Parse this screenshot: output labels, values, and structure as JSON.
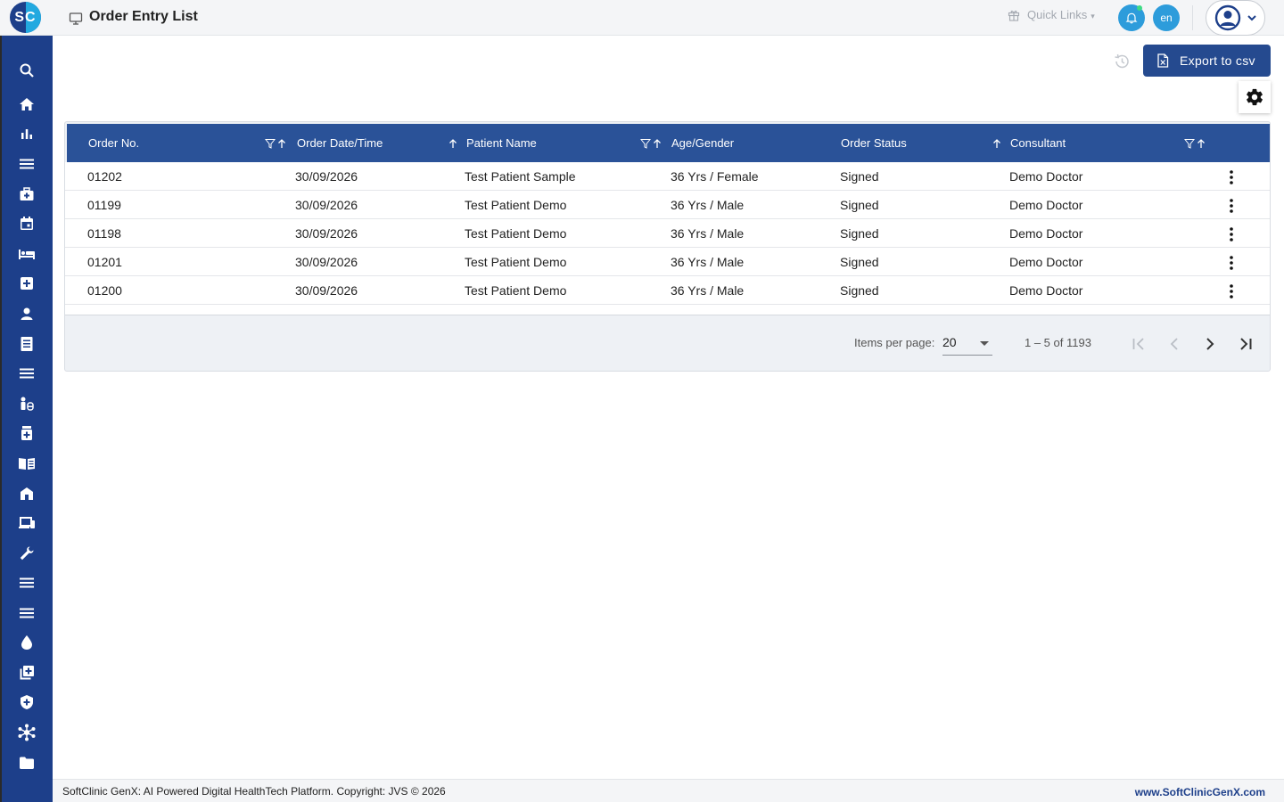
{
  "app": {
    "logo_text": "SC",
    "page_title": "Order Entry List"
  },
  "header": {
    "quick_links_label": "Quick Links",
    "language_label": "en"
  },
  "sidebar": {
    "items": [
      {
        "icon": "search-icon"
      },
      {
        "icon": "home-icon"
      },
      {
        "icon": "bar-chart-icon"
      },
      {
        "icon": "menu-icon"
      },
      {
        "icon": "medical-bag-icon"
      },
      {
        "icon": "calendar-icon"
      },
      {
        "icon": "bed-icon"
      },
      {
        "icon": "hospital-plus-icon"
      },
      {
        "icon": "person-icon"
      },
      {
        "icon": "document-list-icon"
      },
      {
        "icon": "menu-icon"
      },
      {
        "icon": "people-pill-icon"
      },
      {
        "icon": "medicine-bottle-icon"
      },
      {
        "icon": "book-icon"
      },
      {
        "icon": "building-icon"
      },
      {
        "icon": "devices-icon"
      },
      {
        "icon": "wrench-icon"
      },
      {
        "icon": "menu-icon"
      },
      {
        "icon": "menu-icon"
      },
      {
        "icon": "blood-drop-icon"
      },
      {
        "icon": "add-library-icon"
      },
      {
        "icon": "shield-plus-icon"
      },
      {
        "icon": "network-hub-icon"
      },
      {
        "icon": "folder-icon"
      }
    ]
  },
  "actions": {
    "export_label": "Export to csv"
  },
  "table": {
    "columns": [
      {
        "label": "Order No."
      },
      {
        "label": "Order Date/Time"
      },
      {
        "label": "Patient Name"
      },
      {
        "label": "Age/Gender"
      },
      {
        "label": "Order Status"
      },
      {
        "label": "Consultant"
      }
    ],
    "rows": [
      {
        "order_no": "01202",
        "date": "30/09/2026",
        "patient": "Test Patient Sample",
        "age_gender": "36 Yrs / Female",
        "status": "Signed",
        "consultant": "Demo Doctor"
      },
      {
        "order_no": "01199",
        "date": "30/09/2026",
        "patient": "Test Patient Demo",
        "age_gender": "36 Yrs / Male",
        "status": "Signed",
        "consultant": "Demo Doctor"
      },
      {
        "order_no": "01198",
        "date": "30/09/2026",
        "patient": "Test Patient Demo",
        "age_gender": "36 Yrs / Male",
        "status": "Signed",
        "consultant": "Demo Doctor"
      },
      {
        "order_no": "01201",
        "date": "30/09/2026",
        "patient": "Test Patient Demo",
        "age_gender": "36 Yrs / Male",
        "status": "Signed",
        "consultant": "Demo Doctor"
      },
      {
        "order_no": "01200",
        "date": "30/09/2026",
        "patient": "Test Patient Demo",
        "age_gender": "36 Yrs / Male",
        "status": "Signed",
        "consultant": "Demo Doctor"
      }
    ]
  },
  "paginator": {
    "items_per_page_label": "Items per page:",
    "items_per_page_value": "20",
    "range_label": "1 – 5 of 1193"
  },
  "footer": {
    "copyright": "SoftClinic GenX: AI Powered Digital HealthTech Platform. Copyright: JVS © 2026",
    "website": "www.SoftClinicGenX.com"
  },
  "colors": {
    "brand_dark": "#1d3f8a",
    "brand_light": "#22a9e0",
    "table_header": "#2a5298",
    "accent": "#2d9cdb"
  }
}
